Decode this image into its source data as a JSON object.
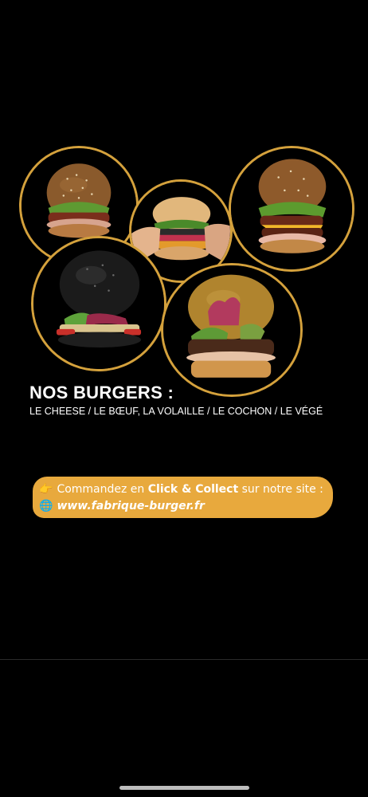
{
  "promo": {
    "title": "NOS BURGERS :",
    "subtitle": "LE CHEESE / LE BŒUF, LA VOLAILLE / LE COCHON / LE VÉGÉ",
    "order_pre": "Commandez en",
    "order_bold": "Click & Collect",
    "order_post": "sur notre site :",
    "website": "www.fabrique-burger.fr",
    "pointing_icon": "👉",
    "globe_icon": "🌐"
  },
  "images": [
    {
      "name": "burger-cheese-sesame"
    },
    {
      "name": "burger-hand-held"
    },
    {
      "name": "burger-cheese-melted"
    },
    {
      "name": "burger-black-bun-chicken"
    },
    {
      "name": "burger-pulled-pork"
    }
  ],
  "colors": {
    "background": "#000000",
    "accent_gold": "#d4a13c",
    "banner": "#e8a93d",
    "text": "#ffffff"
  }
}
